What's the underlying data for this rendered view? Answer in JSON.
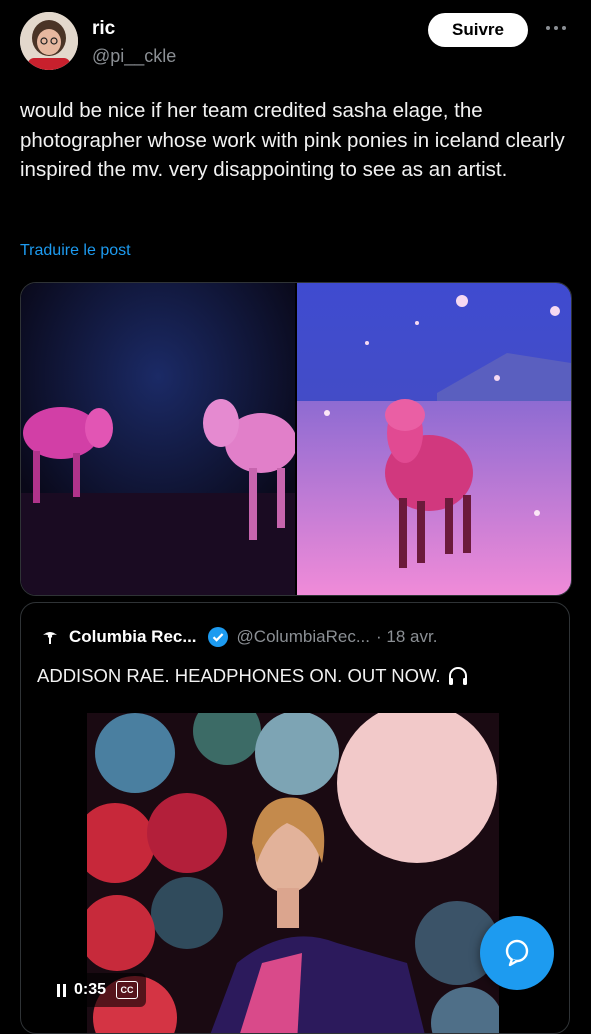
{
  "post": {
    "author_name": "ric",
    "author_handle": "@pi__ckle",
    "follow_label": "Suivre",
    "more_icon": "more-icon",
    "text": "would be nice if her team credited sasha elage, the photographer whose work with pink ponies in iceland clearly inspired the mv. very disappointing to see as an artist.",
    "translate_label": "Traduire le post",
    "link_color": "#1d9bf0"
  },
  "quoted": {
    "author_name": "Columbia Rec...",
    "author_handle": "@ColumbiaRec...",
    "date": "· 18 avr.",
    "text": "ADDISON RAE. HEADPHONES ON. OUT NOW.",
    "text_icon": "headphones-icon",
    "video": {
      "time": "0:35",
      "cc_label": "CC",
      "state": "playing"
    }
  },
  "fab": {
    "icon": "compose-message-icon"
  }
}
